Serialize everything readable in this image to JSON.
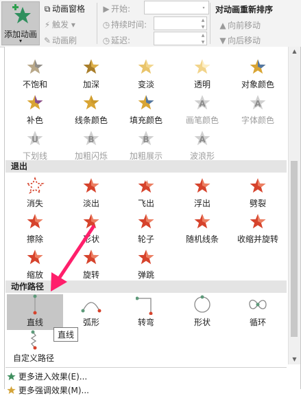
{
  "ribbon": {
    "add_animation": "添加动画",
    "add_arrow": "▾",
    "animation_pane": "动画窗格",
    "trigger": "触发",
    "trigger_arrow": "▾",
    "animation_painter": "动画刷",
    "start_label": "开始:",
    "duration_label": "持续时间:",
    "delay_label": "延迟:",
    "reorder_title": "对动画重新排序",
    "move_earlier": "向前移动",
    "move_later": "向后移动"
  },
  "emphasis": [
    {
      "label": "不饱和"
    },
    {
      "label": "加深"
    },
    {
      "label": "变淡"
    },
    {
      "label": "透明"
    },
    {
      "label": "对象颜色"
    },
    {
      "label": "补色"
    },
    {
      "label": "线条颜色"
    },
    {
      "label": "填充颜色"
    },
    {
      "label": "画笔颜色"
    },
    {
      "label": "字体颜色"
    },
    {
      "label": "下划线"
    },
    {
      "label": "加粗闪烁"
    },
    {
      "label": "加粗展示"
    },
    {
      "label": "波浪形"
    }
  ],
  "exit_section": "退出",
  "exit": [
    {
      "label": "消失"
    },
    {
      "label": "淡出"
    },
    {
      "label": "飞出"
    },
    {
      "label": "浮出"
    },
    {
      "label": "劈裂"
    },
    {
      "label": "擦除"
    },
    {
      "label": "形状"
    },
    {
      "label": "轮子"
    },
    {
      "label": "随机线条"
    },
    {
      "label": "收缩并旋转"
    },
    {
      "label": "缩放"
    },
    {
      "label": "旋转"
    },
    {
      "label": "弹跳"
    }
  ],
  "path_section": "动作路径",
  "paths": [
    {
      "label": "直线"
    },
    {
      "label": "弧形"
    },
    {
      "label": "转弯"
    },
    {
      "label": "形状"
    },
    {
      "label": "循环"
    },
    {
      "label": "自定义路径"
    }
  ],
  "tooltip": "直线",
  "menu": {
    "more_entrance": "更多进入效果(E)...",
    "more_emphasis": "更多强调效果(M)..."
  },
  "colors": {
    "exit_red": "#d6432c",
    "gold": "#c9a24a",
    "path_green": "#5e9a7a",
    "arrow_pink": "#ff1f6b"
  }
}
